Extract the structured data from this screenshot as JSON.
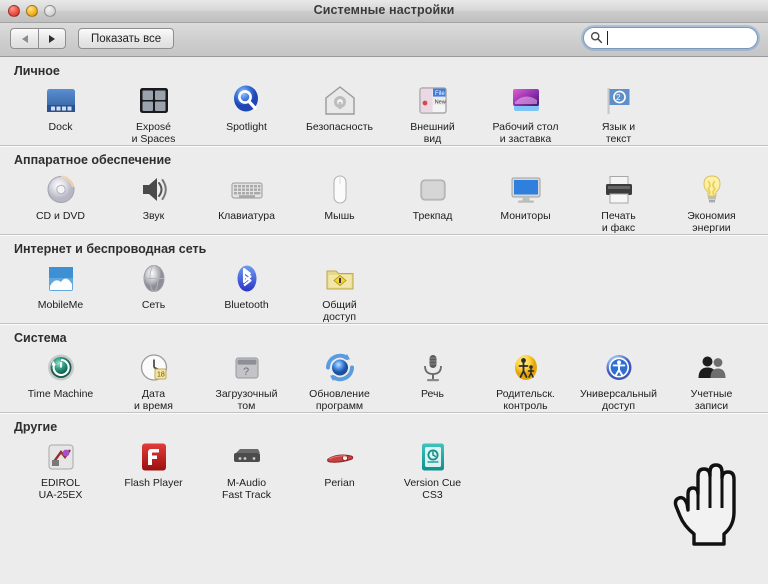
{
  "window": {
    "title": "Системные настройки",
    "controls": {
      "close": "close-button",
      "minimize": "minimize-button",
      "zoom": "zoom-button"
    }
  },
  "toolbar": {
    "back_label": "◀",
    "forward_label": "▶",
    "show_all_label": "Показать все",
    "search": {
      "value": "",
      "placeholder": ""
    }
  },
  "sections": [
    {
      "title": "Личное",
      "items": [
        {
          "label": "Dock",
          "icon": "dock-icon"
        },
        {
          "label": "Exposé\nи Spaces",
          "icon": "expose-spaces-icon"
        },
        {
          "label": "Spotlight",
          "icon": "spotlight-icon"
        },
        {
          "label": "Безопасность",
          "icon": "security-icon"
        },
        {
          "label": "Внешний\nвид",
          "icon": "appearance-icon"
        },
        {
          "label": "Рабочий стол\nи заставка",
          "icon": "desktop-screensaver-icon"
        },
        {
          "label": "Язык и\nтекст",
          "icon": "language-text-icon"
        }
      ]
    },
    {
      "title": "Аппаратное обеспечение",
      "items": [
        {
          "label": "CD и DVD",
          "icon": "cd-dvd-icon"
        },
        {
          "label": "Звук",
          "icon": "sound-icon"
        },
        {
          "label": "Клавиатура",
          "icon": "keyboard-icon"
        },
        {
          "label": "Мышь",
          "icon": "mouse-icon"
        },
        {
          "label": "Трекпад",
          "icon": "trackpad-icon"
        },
        {
          "label": "Мониторы",
          "icon": "displays-icon"
        },
        {
          "label": "Печать\nи факс",
          "icon": "print-fax-icon"
        },
        {
          "label": "Экономия\nэнергии",
          "icon": "energy-saver-icon"
        }
      ]
    },
    {
      "title": "Интернет и беспроводная сеть",
      "items": [
        {
          "label": "MobileMe",
          "icon": "mobileme-icon"
        },
        {
          "label": "Сеть",
          "icon": "network-icon"
        },
        {
          "label": "Bluetooth",
          "icon": "bluetooth-icon"
        },
        {
          "label": "Общий\nдоступ",
          "icon": "sharing-icon"
        }
      ]
    },
    {
      "title": "Система",
      "items": [
        {
          "label": "Time Machine",
          "icon": "time-machine-icon"
        },
        {
          "label": "Дата\nи время",
          "icon": "date-time-icon"
        },
        {
          "label": "Загрузочный\nтом",
          "icon": "startup-disk-icon"
        },
        {
          "label": "Обновление\nпрограмм",
          "icon": "software-update-icon"
        },
        {
          "label": "Речь",
          "icon": "speech-icon"
        },
        {
          "label": "Родительск.\nконтроль",
          "icon": "parental-controls-icon"
        },
        {
          "label": "Универсальный\nдоступ",
          "icon": "universal-access-icon"
        },
        {
          "label": "Учетные\nзаписи",
          "icon": "accounts-icon"
        }
      ]
    },
    {
      "title": "Другие",
      "items": [
        {
          "label": "EDIROL\nUA-25EX",
          "icon": "edirol-icon"
        },
        {
          "label": "Flash Player",
          "icon": "flash-player-icon"
        },
        {
          "label": "M-Audio\nFast Track",
          "icon": "m-audio-icon"
        },
        {
          "label": "Perian",
          "icon": "perian-icon"
        },
        {
          "label": "Version Cue\nCS3",
          "icon": "version-cue-icon"
        }
      ]
    }
  ],
  "cursor": {
    "type": "pointing-hand-cursor"
  },
  "colors": {
    "window_bg": "#ececec",
    "titlebar": "#cccccc",
    "section_title": "#2e2e2e",
    "search_focus": "#6ea0d7"
  }
}
